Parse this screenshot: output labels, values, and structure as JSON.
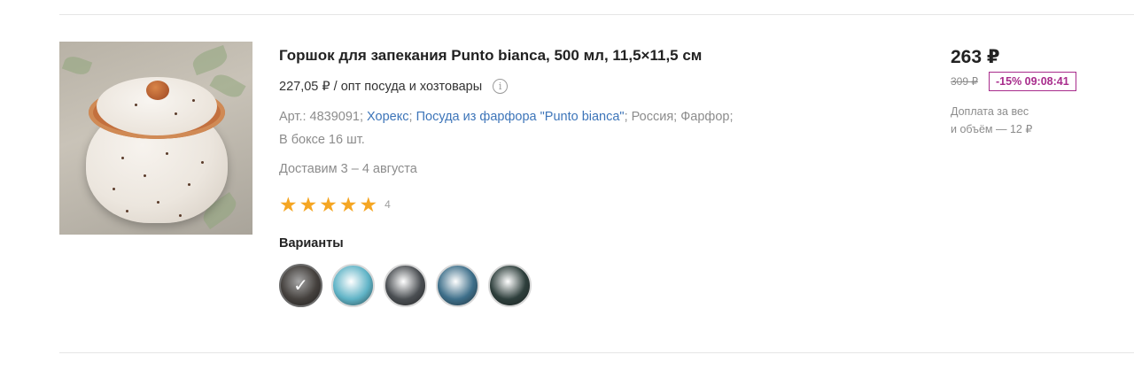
{
  "product": {
    "title": "Горшок для запекания Punto bianca, 500 мл, 11,5×11,5 см",
    "wholesale_text": "227,05 ₽ / опт посуда и хозтовары",
    "info_icon": "info-icon",
    "article_prefix": "Арт.: 4839091; ",
    "category_link": "Хорекс",
    "separator": "; ",
    "collection_link": "Посуда из фарфора \"Punto bianca\"",
    "meta_suffix": "; Россия; Фарфор;",
    "box_count": "В боксе 16 шт.",
    "delivery": "Доставим 3 – 4 августа",
    "rating": {
      "stars": 5,
      "count": "4",
      "star_glyph": "★"
    },
    "variants_label": "Варианты",
    "variants": [
      {
        "color": "#6b6560",
        "selected": true
      },
      {
        "color": "#5fb3c6",
        "selected": false
      },
      {
        "color": "#4a4e52",
        "selected": false
      },
      {
        "color": "#3e6f8a",
        "selected": false
      },
      {
        "color": "#2e3f3c",
        "selected": false
      }
    ]
  },
  "pricing": {
    "price": "263 ₽",
    "old_price": "309 ₽",
    "discount": "-15% 09:08:41",
    "surcharge_line1": "Доплата за вес",
    "surcharge_line2": "и объём — 12 ₽"
  },
  "colors": {
    "link": "#3d75b9",
    "star": "#f5a623",
    "discount": "#a82c8c"
  }
}
